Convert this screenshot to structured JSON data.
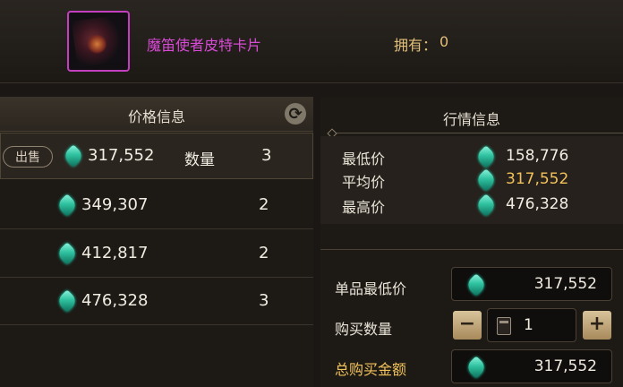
{
  "item": {
    "name": "魔笛使者皮特卡片",
    "owned_label": "拥有：",
    "owned_value": "0"
  },
  "price_panel": {
    "title": "价格信息",
    "sell_label": "出售",
    "quantity_label": "数量",
    "rows": [
      {
        "price": "317,552",
        "quantity": "3"
      },
      {
        "price": "349,307",
        "quantity": "2"
      },
      {
        "price": "412,817",
        "quantity": "2"
      },
      {
        "price": "476,328",
        "quantity": "3"
      }
    ]
  },
  "market_panel": {
    "title": "行情信息",
    "min_label": "最低价",
    "min_value": "158,776",
    "avg_label": "平均价",
    "avg_value": "317,552",
    "max_label": "最高价",
    "max_value": "476,328"
  },
  "purchase": {
    "unit_min_label": "单品最低价",
    "unit_min_value": "317,552",
    "qty_label": "购买数量",
    "qty_value": "1",
    "minus": "−",
    "plus": "+",
    "total_label": "总购买金额",
    "total_value": "317,552"
  },
  "colors": {
    "accent_purple": "#d94ad6",
    "gold": "#f1c15a",
    "gem": "#2fc2a0"
  },
  "icons": [
    "item-card-icon",
    "refresh-icon",
    "gem-icon",
    "calculator-icon"
  ]
}
